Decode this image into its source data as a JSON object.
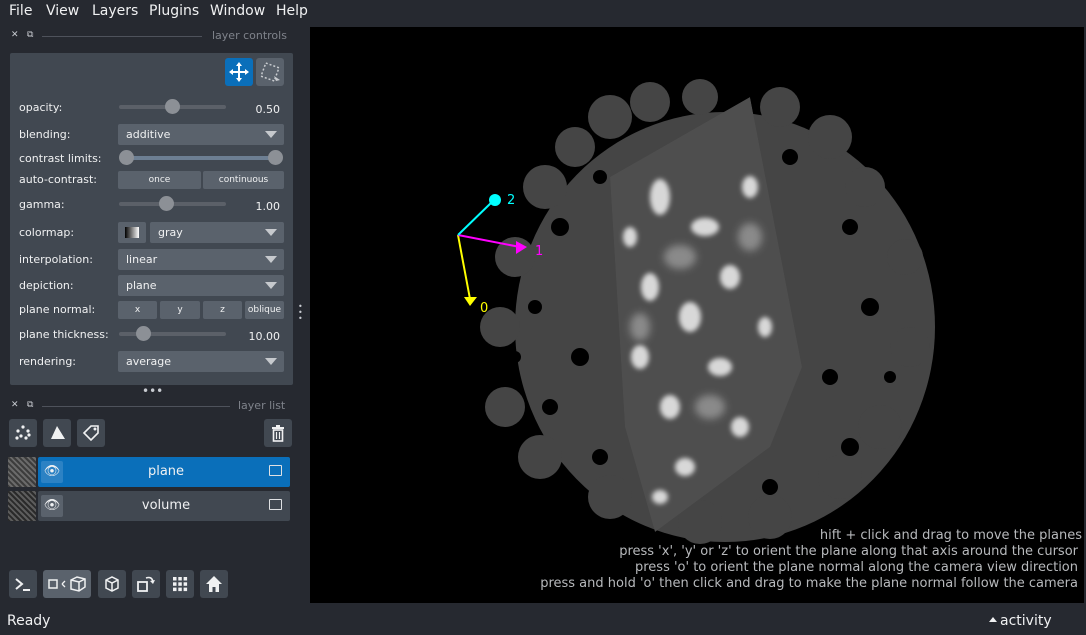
{
  "menu": [
    "File",
    "View",
    "Layers",
    "Plugins",
    "Window",
    "Help"
  ],
  "controls_header": "layer controls",
  "layer_list_header": "layer list",
  "controls": {
    "opacity": {
      "label": "opacity:",
      "value": "0.50",
      "fraction": 0.5
    },
    "blending": {
      "label": "blending:",
      "value": "additive"
    },
    "contrast_limits": {
      "label": "contrast limits:"
    },
    "auto_contrast": {
      "label": "auto-contrast:",
      "once": "once",
      "continuous": "continuous"
    },
    "gamma": {
      "label": "gamma:",
      "value": "1.00",
      "fraction": 0.5
    },
    "colormap": {
      "label": "colormap:",
      "value": "gray"
    },
    "interpolation": {
      "label": "interpolation:",
      "value": "linear"
    },
    "depiction": {
      "label": "depiction:",
      "value": "plane"
    },
    "plane_normal": {
      "label": "plane normal:",
      "x": "x",
      "y": "y",
      "z": "z",
      "oblique": "oblique"
    },
    "plane_thickness": {
      "label": "plane thickness:",
      "value": "10.00"
    },
    "rendering": {
      "label": "rendering:",
      "value": "average"
    }
  },
  "layers": [
    {
      "name": "plane",
      "selected": true
    },
    {
      "name": "volume",
      "selected": false
    }
  ],
  "axes": {
    "label_0": "0",
    "label_1": "1",
    "label_2": "2"
  },
  "hints": [
    "hift + click and drag to move the planes",
    "press 'x', 'y' or 'z' to orient the plane along that axis around the cursor",
    "press 'o' to orient the plane normal along the camera view direction",
    "press and hold 'o' then click and drag to make the plane normal follow the camera"
  ],
  "status": {
    "left": "Ready",
    "activity": "activity"
  },
  "colors": {
    "accent": "#0a6fba",
    "axis0": "#ffff00",
    "axis1": "#ff00ff",
    "axis2": "#00ffff"
  }
}
